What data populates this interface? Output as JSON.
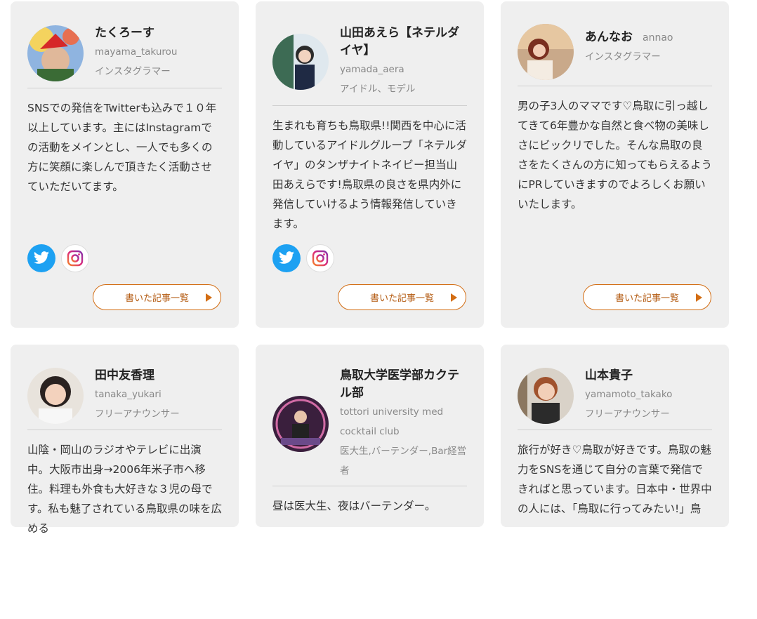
{
  "button_label": "書いた記事一覧",
  "colors": {
    "accent": "#d36d13",
    "card_bg": "#efefef",
    "twitter": "#1da1f2"
  },
  "cards": [
    {
      "name": "たくろーす",
      "handle": "mayama_takurou",
      "role": "インスタグラマー",
      "bio": "SNSでの発信をTwitterも込みで１０年以上しています。主にはInstagramでの活動をメインとし、一人でも多くの方に笑顔に楽しんで頂きたく活動させていただいてます。",
      "socials": [
        "twitter-icon",
        "instagram-icon"
      ]
    },
    {
      "name": "山田あえら【ネテルダイヤ】",
      "handle": "yamada_aera",
      "role": "アイドル、モデル",
      "bio": "生まれも育ちも鳥取県!!関西を中心に活動しているアイドルグループ「ネテルダイヤ」のタンザナイトネイビー担当山田あえらです!鳥取県の良さを県内外に発信していけるよう情報発信していきます。",
      "socials": [
        "twitter-icon",
        "instagram-icon"
      ]
    },
    {
      "name": "あんなお",
      "handle": "annao",
      "role": "インスタグラマー",
      "bio": "男の子3人のママです♡鳥取に引っ越してきて6年豊かな自然と食べ物の美味しさにビックリでした。そんな鳥取の良さをたくさんの方に知ってもらえるようにPRしていきますのでよろしくお願いいたします。",
      "socials": []
    },
    {
      "name": "田中友香理",
      "handle": "tanaka_yukari",
      "role": "フリーアナウンサー",
      "bio": "山陰・岡山のラジオやテレビに出演中。大阪市出身→2006年米子市へ移住。料理も外食も大好きな３児の母です。私も魅了されている鳥取県の味を広める"
    },
    {
      "name": "鳥取大学医学部カクテル部",
      "handle": "tottori university med cocktail club",
      "role": "医大生,バーテンダー,Bar経営者",
      "bio": "昼は医大生、夜はバーテンダー。"
    },
    {
      "name": "山本貴子",
      "handle": "yamamoto_takako",
      "role": "フリーアナウンサー",
      "bio": "旅行が好き♡鳥取が好きです。鳥取の魅力をSNSを通じて自分の言葉で発信できればと思っています。日本中・世界中の人には、「鳥取に行ってみたい!」鳥"
    }
  ]
}
